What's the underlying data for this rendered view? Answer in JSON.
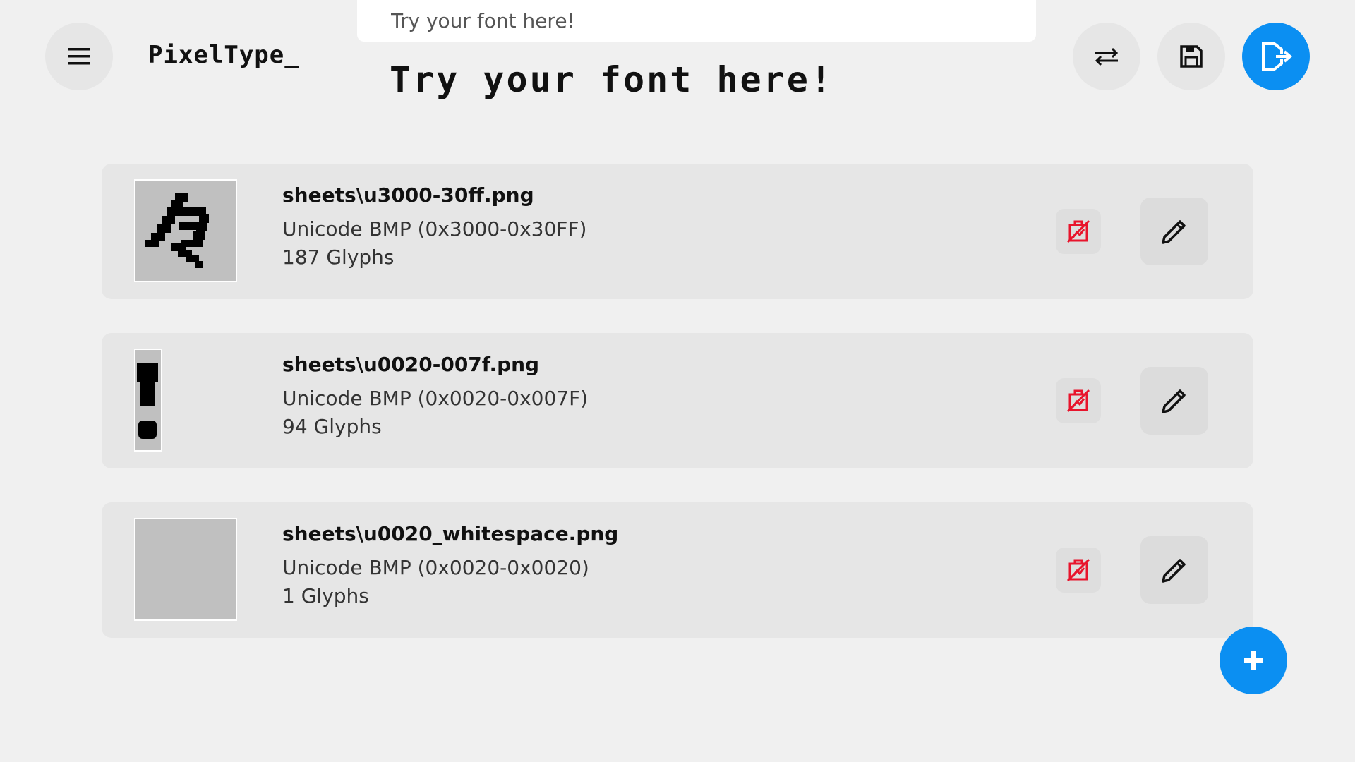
{
  "app": {
    "logo_text": "PixelType_"
  },
  "search": {
    "placeholder": "Try your font here!"
  },
  "preview": {
    "text": "Try your font here!"
  },
  "header": {
    "menu_icon": "hamburger-menu-icon",
    "swap_icon": "swap-arrows-icon",
    "save_icon": "save-floppy-icon",
    "export_icon": "export-icon"
  },
  "colors": {
    "accent": "#0b8ff2",
    "delete": "#e8142c",
    "card": "#e6e6e6",
    "background": "#f0f0f0"
  },
  "sheets": [
    {
      "name": "sheets\\u3000-30ff.png",
      "range": "Unicode BMP (0x3000-0x30FF)",
      "count": "187 Glyphs",
      "thumbnail": "katakana-glyph"
    },
    {
      "name": "sheets\\u0020-007f.png",
      "range": "Unicode BMP (0x0020-0x007F)",
      "count": "94 Glyphs",
      "thumbnail": "exclamation-glyph"
    },
    {
      "name": "sheets\\u0020_whitespace.png",
      "range": "Unicode BMP (0x0020-0x0020)",
      "count": "1 Glyphs",
      "thumbnail": "blank-glyph"
    }
  ],
  "actions": {
    "delete_icon": "delete-image-icon",
    "edit_icon": "pencil-icon",
    "add_icon": "plus-icon"
  }
}
